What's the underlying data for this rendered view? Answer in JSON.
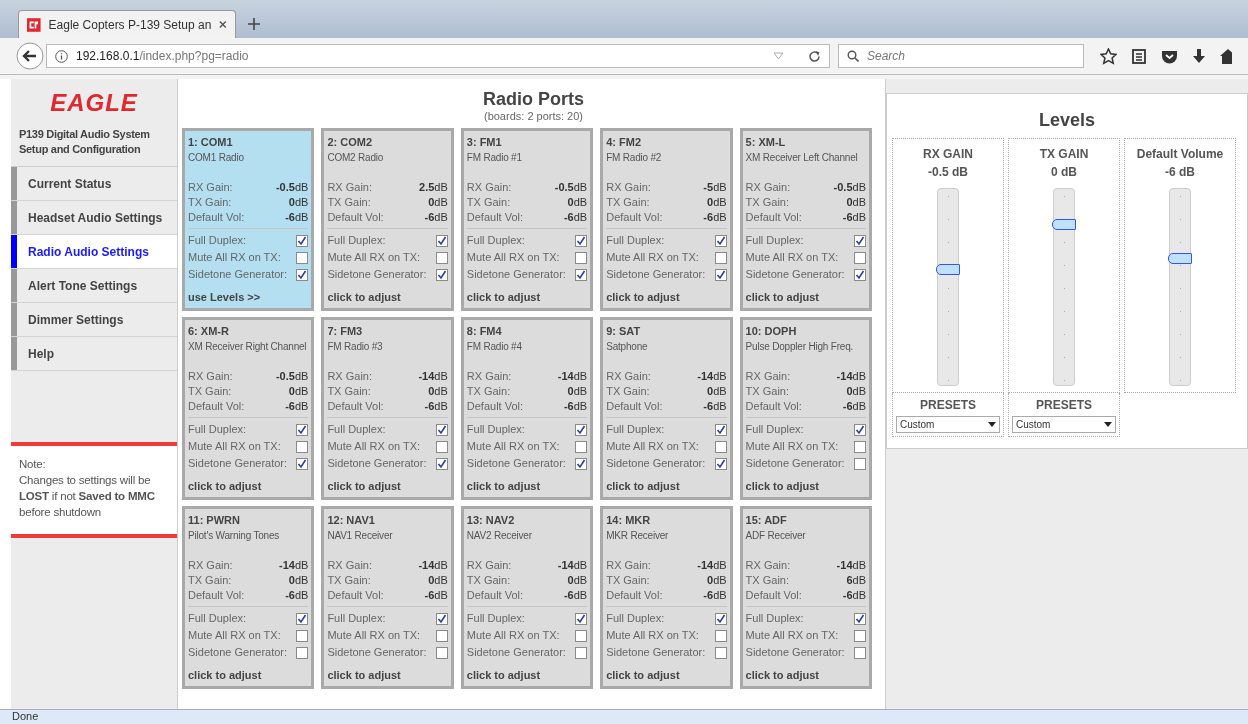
{
  "browser": {
    "tab_title": "Eagle Copters P-139 Setup an",
    "url_host": "192.168.0.1",
    "url_path": "/index.php?pg=radio",
    "search_placeholder": "Search"
  },
  "sidebar": {
    "logo": "EAGLE",
    "subtitle": "P139 Digital Audio System Setup and Configuration",
    "items": [
      {
        "label": "Current Status",
        "selected": false
      },
      {
        "label": "Headset Audio Settings",
        "selected": false
      },
      {
        "label": "Radio Audio Settings",
        "selected": true
      },
      {
        "label": "Alert Tone Settings",
        "selected": false
      },
      {
        "label": "Dimmer Settings",
        "selected": false
      },
      {
        "label": "Help",
        "selected": false
      }
    ],
    "note": "Note:\nChanges to settings will be **LOST** if not **Saved to MMC** before shutdown"
  },
  "radio_ports": {
    "title": "Radio Ports",
    "subtitle": "(boards: 2 ports: 20)",
    "ports": [
      {
        "name": "1: COM1",
        "description": "COM1 Radio",
        "values": [
          {
            "label": "RX Gain:",
            "value": "-0.5",
            "unit": "dB"
          },
          {
            "label": "TX Gain:",
            "value": "0",
            "unit": "dB"
          },
          {
            "label": "Default Vol:",
            "value": "-6",
            "unit": "dB"
          }
        ],
        "options": [
          {
            "label": "Full Duplex:",
            "checked": true
          },
          {
            "label": "Mute All RX on TX:",
            "checked": false
          },
          {
            "label": "Sidetone Generator:",
            "checked": true
          }
        ],
        "action": "use Levels >>",
        "selected": true
      },
      {
        "name": "2: COM2",
        "description": "COM2 Radio",
        "values": [
          {
            "label": "RX Gain:",
            "value": "2.5",
            "unit": "dB"
          },
          {
            "label": "TX Gain:",
            "value": "0",
            "unit": "dB"
          },
          {
            "label": "Default Vol:",
            "value": "-6",
            "unit": "dB"
          }
        ],
        "options": [
          {
            "label": "Full Duplex:",
            "checked": true
          },
          {
            "label": "Mute All RX on TX:",
            "checked": false
          },
          {
            "label": "Sidetone Generator:",
            "checked": true
          }
        ],
        "action": "click to adjust",
        "selected": false
      },
      {
        "name": "3: FM1",
        "description": "FM Radio #1",
        "values": [
          {
            "label": "RX Gain:",
            "value": "-0.5",
            "unit": "dB"
          },
          {
            "label": "TX Gain:",
            "value": "0",
            "unit": "dB"
          },
          {
            "label": "Default Vol:",
            "value": "-6",
            "unit": "dB"
          }
        ],
        "options": [
          {
            "label": "Full Duplex:",
            "checked": true
          },
          {
            "label": "Mute All RX on TX:",
            "checked": false
          },
          {
            "label": "Sidetone Generator:",
            "checked": true
          }
        ],
        "action": "click to adjust",
        "selected": false
      },
      {
        "name": "4: FM2",
        "description": "FM Radio #2",
        "values": [
          {
            "label": "RX Gain:",
            "value": "-5",
            "unit": "dB"
          },
          {
            "label": "TX Gain:",
            "value": "0",
            "unit": "dB"
          },
          {
            "label": "Default Vol:",
            "value": "-6",
            "unit": "dB"
          }
        ],
        "options": [
          {
            "label": "Full Duplex:",
            "checked": true
          },
          {
            "label": "Mute All RX on TX:",
            "checked": false
          },
          {
            "label": "Sidetone Generator:",
            "checked": true
          }
        ],
        "action": "click to adjust",
        "selected": false
      },
      {
        "name": "5: XM-L",
        "description": "XM Receiver Left Channel",
        "values": [
          {
            "label": "RX Gain:",
            "value": "-0.5",
            "unit": "dB"
          },
          {
            "label": "TX Gain:",
            "value": "0",
            "unit": "dB"
          },
          {
            "label": "Default Vol:",
            "value": "-6",
            "unit": "dB"
          }
        ],
        "options": [
          {
            "label": "Full Duplex:",
            "checked": true
          },
          {
            "label": "Mute All RX on TX:",
            "checked": false
          },
          {
            "label": "Sidetone Generator:",
            "checked": true
          }
        ],
        "action": "click to adjust",
        "selected": false
      },
      {
        "name": "6: XM-R",
        "description": "XM Receiver Right Channel",
        "values": [
          {
            "label": "RX Gain:",
            "value": "-0.5",
            "unit": "dB"
          },
          {
            "label": "TX Gain:",
            "value": "0",
            "unit": "dB"
          },
          {
            "label": "Default Vol:",
            "value": "-6",
            "unit": "dB"
          }
        ],
        "options": [
          {
            "label": "Full Duplex:",
            "checked": true
          },
          {
            "label": "Mute All RX on TX:",
            "checked": false
          },
          {
            "label": "Sidetone Generator:",
            "checked": true
          }
        ],
        "action": "click to adjust",
        "selected": false
      },
      {
        "name": "7: FM3",
        "description": "FM Radio #3",
        "values": [
          {
            "label": "RX Gain:",
            "value": "-14",
            "unit": "dB"
          },
          {
            "label": "TX Gain:",
            "value": "0",
            "unit": "dB"
          },
          {
            "label": "Default Vol:",
            "value": "-6",
            "unit": "dB"
          }
        ],
        "options": [
          {
            "label": "Full Duplex:",
            "checked": true
          },
          {
            "label": "Mute All RX on TX:",
            "checked": false
          },
          {
            "label": "Sidetone Generator:",
            "checked": true
          }
        ],
        "action": "click to adjust",
        "selected": false
      },
      {
        "name": "8: FM4",
        "description": "FM Radio #4",
        "values": [
          {
            "label": "RX Gain:",
            "value": "-14",
            "unit": "dB"
          },
          {
            "label": "TX Gain:",
            "value": "0",
            "unit": "dB"
          },
          {
            "label": "Default Vol:",
            "value": "-6",
            "unit": "dB"
          }
        ],
        "options": [
          {
            "label": "Full Duplex:",
            "checked": true
          },
          {
            "label": "Mute All RX on TX:",
            "checked": false
          },
          {
            "label": "Sidetone Generator:",
            "checked": true
          }
        ],
        "action": "click to adjust",
        "selected": false
      },
      {
        "name": "9: SAT",
        "description": "Satphone",
        "values": [
          {
            "label": "RX Gain:",
            "value": "-14",
            "unit": "dB"
          },
          {
            "label": "TX Gain:",
            "value": "0",
            "unit": "dB"
          },
          {
            "label": "Default Vol:",
            "value": "-6",
            "unit": "dB"
          }
        ],
        "options": [
          {
            "label": "Full Duplex:",
            "checked": true
          },
          {
            "label": "Mute All RX on TX:",
            "checked": false
          },
          {
            "label": "Sidetone Generator:",
            "checked": true
          }
        ],
        "action": "click to adjust",
        "selected": false
      },
      {
        "name": "10: DOPH",
        "description": "Pulse Doppler High Freq.",
        "values": [
          {
            "label": "RX Gain:",
            "value": "-14",
            "unit": "dB"
          },
          {
            "label": "TX Gain:",
            "value": "0",
            "unit": "dB"
          },
          {
            "label": "Default Vol:",
            "value": "-6",
            "unit": "dB"
          }
        ],
        "options": [
          {
            "label": "Full Duplex:",
            "checked": true
          },
          {
            "label": "Mute All RX on TX:",
            "checked": false
          },
          {
            "label": "Sidetone Generator:",
            "checked": false
          }
        ],
        "action": "click to adjust",
        "selected": false
      },
      {
        "name": "11: PWRN",
        "description": "Pilot's Warning Tones",
        "values": [
          {
            "label": "RX Gain:",
            "value": "-14",
            "unit": "dB"
          },
          {
            "label": "TX Gain:",
            "value": "0",
            "unit": "dB"
          },
          {
            "label": "Default Vol:",
            "value": "-6",
            "unit": "dB"
          }
        ],
        "options": [
          {
            "label": "Full Duplex:",
            "checked": true
          },
          {
            "label": "Mute All RX on TX:",
            "checked": false
          },
          {
            "label": "Sidetone Generator:",
            "checked": false
          }
        ],
        "action": "click to adjust",
        "selected": false
      },
      {
        "name": "12: NAV1",
        "description": "NAV1 Receiver",
        "values": [
          {
            "label": "RX Gain:",
            "value": "-14",
            "unit": "dB"
          },
          {
            "label": "TX Gain:",
            "value": "0",
            "unit": "dB"
          },
          {
            "label": "Default Vol:",
            "value": "-6",
            "unit": "dB"
          }
        ],
        "options": [
          {
            "label": "Full Duplex:",
            "checked": true
          },
          {
            "label": "Mute All RX on TX:",
            "checked": false
          },
          {
            "label": "Sidetone Generator:",
            "checked": false
          }
        ],
        "action": "click to adjust",
        "selected": false
      },
      {
        "name": "13: NAV2",
        "description": "NAV2 Receiver",
        "values": [
          {
            "label": "RX Gain:",
            "value": "-14",
            "unit": "dB"
          },
          {
            "label": "TX Gain:",
            "value": "0",
            "unit": "dB"
          },
          {
            "label": "Default Vol:",
            "value": "-6",
            "unit": "dB"
          }
        ],
        "options": [
          {
            "label": "Full Duplex:",
            "checked": true
          },
          {
            "label": "Mute All RX on TX:",
            "checked": false
          },
          {
            "label": "Sidetone Generator:",
            "checked": false
          }
        ],
        "action": "click to adjust",
        "selected": false
      },
      {
        "name": "14: MKR",
        "description": "MKR Receiver",
        "values": [
          {
            "label": "RX Gain:",
            "value": "-14",
            "unit": "dB"
          },
          {
            "label": "TX Gain:",
            "value": "0",
            "unit": "dB"
          },
          {
            "label": "Default Vol:",
            "value": "-6",
            "unit": "dB"
          }
        ],
        "options": [
          {
            "label": "Full Duplex:",
            "checked": true
          },
          {
            "label": "Mute All RX on TX:",
            "checked": false
          },
          {
            "label": "Sidetone Generator:",
            "checked": false
          }
        ],
        "action": "click to adjust",
        "selected": false
      },
      {
        "name": "15: ADF",
        "description": "ADF Receiver",
        "values": [
          {
            "label": "RX Gain:",
            "value": "-14",
            "unit": "dB"
          },
          {
            "label": "TX Gain:",
            "value": "6",
            "unit": "dB"
          },
          {
            "label": "Default Vol:",
            "value": "-6",
            "unit": "dB"
          }
        ],
        "options": [
          {
            "label": "Full Duplex:",
            "checked": true
          },
          {
            "label": "Mute All RX on TX:",
            "checked": false
          },
          {
            "label": "Sidetone Generator:",
            "checked": false
          }
        ],
        "action": "click to adjust",
        "selected": false
      }
    ]
  },
  "levels": {
    "title": "Levels",
    "sliders": [
      {
        "label": "RX GAIN",
        "reading": "-0.5 dB",
        "level": 0.6,
        "presets_label": "PRESETS",
        "preset": "Custom"
      },
      {
        "label": "TX GAIN",
        "reading": "0 dB",
        "level": 0.84,
        "presets_label": "PRESETS",
        "preset": "Custom"
      },
      {
        "label": "Default Volume",
        "reading": "-6 dB",
        "level": 0.66
      }
    ]
  },
  "status_bar": "Done"
}
